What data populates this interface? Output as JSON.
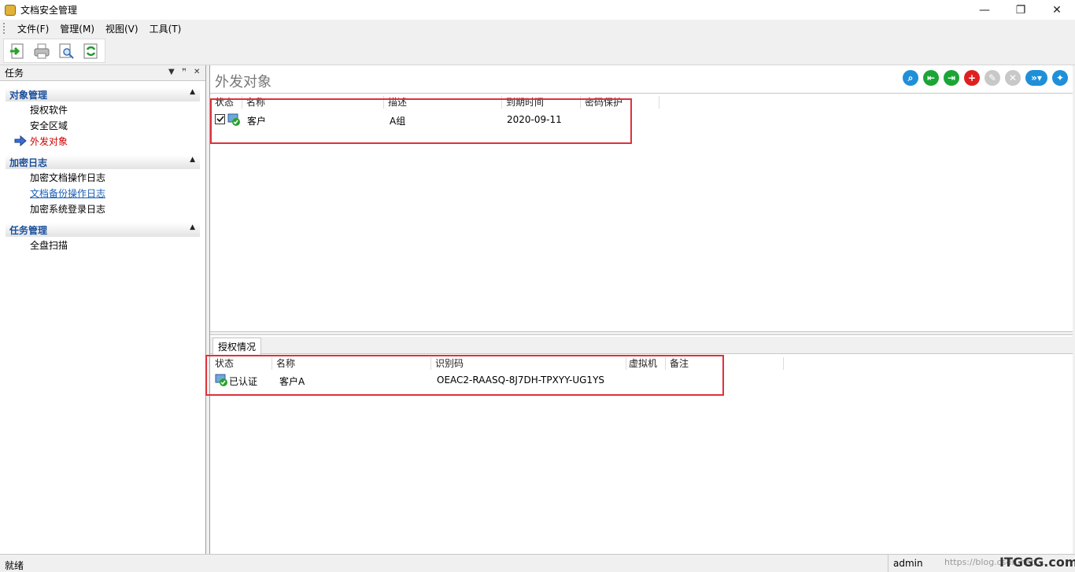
{
  "window": {
    "title": "文档安全管理",
    "minimize": "—",
    "maximize": "❐",
    "close": "✕"
  },
  "menu": [
    "文件(F)",
    "管理(M)",
    "视图(V)",
    "工具(T)"
  ],
  "toolbar": {
    "icons": [
      "export-icon",
      "print-icon",
      "preview-icon",
      "refresh-icon"
    ]
  },
  "task_pane": {
    "title": "任务",
    "controls": {
      "dropdown": "▼",
      "pin": "ꟸ",
      "close": "✕"
    },
    "groups": [
      {
        "title": "对象管理",
        "items": [
          {
            "label": "授权软件",
            "state": "normal"
          },
          {
            "label": "安全区域",
            "state": "normal"
          },
          {
            "label": "外发对象",
            "state": "active"
          }
        ]
      },
      {
        "title": "加密日志",
        "items": [
          {
            "label": "加密文档操作日志",
            "state": "normal"
          },
          {
            "label": "文档备份操作日志",
            "state": "link"
          },
          {
            "label": "加密系统登录日志",
            "state": "normal"
          }
        ]
      },
      {
        "title": "任务管理",
        "items": [
          {
            "label": "全盘扫描",
            "state": "normal"
          }
        ]
      }
    ]
  },
  "main": {
    "title": "外发对象",
    "actions": [
      "search-icon",
      "back-icon",
      "forward-icon",
      "add-icon",
      "edit-icon",
      "delete-icon",
      "more-icon",
      "settings-icon"
    ],
    "table": {
      "columns": [
        "状态",
        "名称",
        "描述",
        "到期时间",
        "密码保护"
      ],
      "rows": [
        {
          "name": "客户",
          "desc": "A组",
          "expire": "2020-09-11",
          "password": ""
        }
      ]
    },
    "detail_tab": "授权情况",
    "detail_table": {
      "columns": [
        "状态",
        "名称",
        "识别码",
        "虚拟机",
        "备注"
      ],
      "rows": [
        {
          "status": "已认证",
          "name": "客户A",
          "code": "OEAC2-RAASQ-8J7DH-TPXYY-UG1YS",
          "vm": "",
          "note": ""
        }
      ]
    }
  },
  "status": {
    "left": "就绪",
    "user": "admin",
    "watermark": "https://blog.csdn.net/...",
    "brand": "ITGGG.com"
  }
}
